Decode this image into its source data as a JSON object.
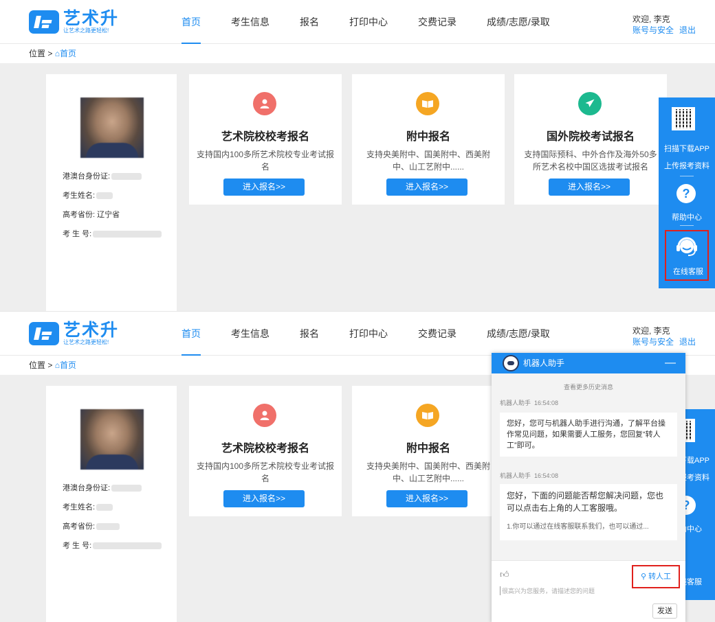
{
  "app": {
    "name": "艺术升",
    "slogan": "让艺术之路更轻松!"
  },
  "nav": {
    "items": [
      "首页",
      "考生信息",
      "报名",
      "打印中心",
      "交费记录",
      "成绩/志愿/录取"
    ],
    "active": "首页"
  },
  "user": {
    "welcome": "欢迎, 李克",
    "account_link": "账号与安全",
    "logout_link": "退出"
  },
  "breadcrumb": {
    "label": "位置 >",
    "home": "首页"
  },
  "profile": {
    "id_label": "港澳台身份证:",
    "name_label": "考生姓名:",
    "province_label": "高考省份:",
    "province_value_top": "辽宁省",
    "exam_no_label": "考 生 号:"
  },
  "cards": [
    {
      "title": "艺术院校校考报名",
      "desc": "支持国内100多所艺术院校专业考试报名",
      "button": "进入报名>>",
      "icon": "person-icon",
      "color": "#f0706a"
    },
    {
      "title": "附中报名",
      "desc": "支持央美附中、国美附中、西美附中、山工艺附中......",
      "button": "进入报名>>",
      "icon": "book-icon",
      "color": "#f5a623"
    },
    {
      "title": "国外院校考试报名",
      "desc": "支持国际预科、中外合作及海外50多所艺术名校中国区选拔考试报名",
      "button": "进入报名>>",
      "icon": "plane-icon",
      "color": "#1cb98f"
    }
  ],
  "sidebar": {
    "download_app": "扫描下载APP",
    "upload": "上传报考资料",
    "help": "帮助中心",
    "help_glyph": "?",
    "customer_service": "在线客服"
  },
  "chat": {
    "title": "机器人助手",
    "minimize": "—",
    "history": "查看更多历史消息",
    "messages": [
      {
        "sender": "机器人助手",
        "time": "16:54:08",
        "text": "您好，您可与机器人助手进行沟通，了解平台操作常见问题，如果需要人工服务，您回复“转人工”即可。"
      },
      {
        "sender": "机器人助手",
        "time": "16:54:08",
        "text": "您好，下面的问题能否帮您解决问题，您也可以点击右上角的人工客服哦。",
        "faq": "1.你可以通过在线客服联系我们，也可以通过..."
      }
    ],
    "human_button": "转人工",
    "input_placeholder": "很高兴为您服务，请描述您的问题",
    "send_button": "发送"
  },
  "colors": {
    "brand": "#1e8cf0",
    "highlight_box": "#e0201c"
  }
}
